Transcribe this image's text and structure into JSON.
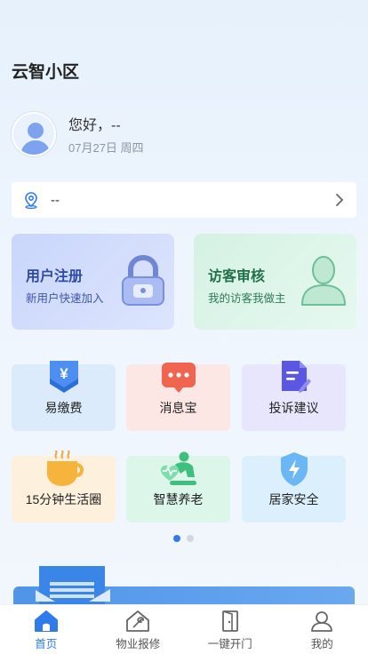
{
  "header": {
    "title": "云智小区"
  },
  "user": {
    "greeting": "您好，--",
    "date": "07月27日 周四"
  },
  "location": {
    "value": "--"
  },
  "cards": [
    {
      "title": "用户注册",
      "subtitle": "新用户快速加入"
    },
    {
      "title": "访客审核",
      "subtitle": "我的访客我做主"
    }
  ],
  "services": [
    {
      "label": "易缴费",
      "icon": "payment-icon"
    },
    {
      "label": "消息宝",
      "icon": "message-icon"
    },
    {
      "label": "投诉建议",
      "icon": "complaint-icon"
    },
    {
      "label": "15分钟生活圈",
      "icon": "coffee-icon"
    },
    {
      "label": "智慧养老",
      "icon": "elderly-care-icon"
    },
    {
      "label": "居家安全",
      "icon": "shield-icon"
    }
  ],
  "carousel": {
    "pages": 2,
    "active": 0
  },
  "tabbar": [
    {
      "label": "首页",
      "icon": "home-icon",
      "active": true
    },
    {
      "label": "物业报修",
      "icon": "repair-icon",
      "active": false
    },
    {
      "label": "一键开门",
      "icon": "door-icon",
      "active": false
    },
    {
      "label": "我的",
      "icon": "user-icon",
      "active": false
    }
  ],
  "colors": {
    "accent": "#2f7bea",
    "background": "#e6f1fc"
  }
}
